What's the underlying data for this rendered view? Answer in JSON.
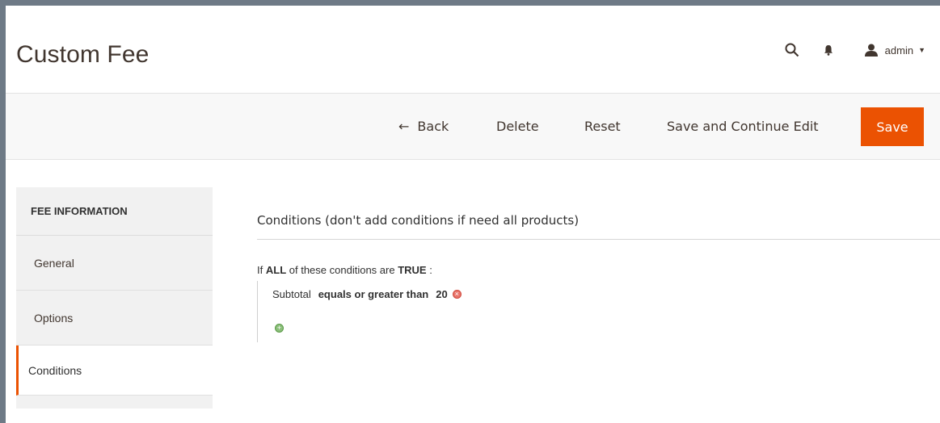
{
  "header": {
    "title": "Custom Fee",
    "user": "admin"
  },
  "actions": {
    "back": "Back",
    "delete": "Delete",
    "reset": "Reset",
    "save_continue": "Save and Continue Edit",
    "save": "Save"
  },
  "sidebar": {
    "title": "FEE INFORMATION",
    "items": [
      {
        "label": "General"
      },
      {
        "label": "Options"
      },
      {
        "label": "Conditions",
        "active": true
      }
    ]
  },
  "conditions": {
    "section_title": "Conditions (don't add conditions if need all products)",
    "rule_prefix": "If",
    "aggregator": "ALL",
    "rule_middle": "of these conditions are",
    "value": "TRUE",
    "rule_suffix": ":",
    "condition": {
      "attribute": "Subtotal",
      "operator": "equals or greater than",
      "value": "20"
    }
  },
  "colors": {
    "accent": "#eb5202",
    "frame": "#6e7a86",
    "remove": "#e8746a",
    "add": "#8bbf7a"
  },
  "icons": [
    "search-icon",
    "bell-icon",
    "user-icon",
    "chevron-down-icon",
    "arrow-left-icon",
    "remove-condition-icon",
    "add-condition-icon"
  ]
}
